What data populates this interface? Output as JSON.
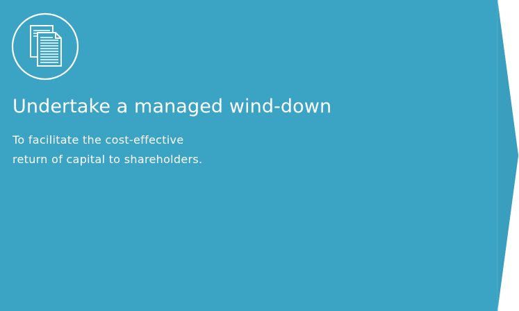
{
  "colors": {
    "panel": "#3ba3c3",
    "panel_shade": "#3a9fbf",
    "text": "#ffffff"
  },
  "icon": "documents-icon",
  "card": {
    "title": "Undertake a managed wind-down",
    "description_lines": [
      "To facilitate the cost-effective",
      "return of capital to shareholders."
    ]
  }
}
